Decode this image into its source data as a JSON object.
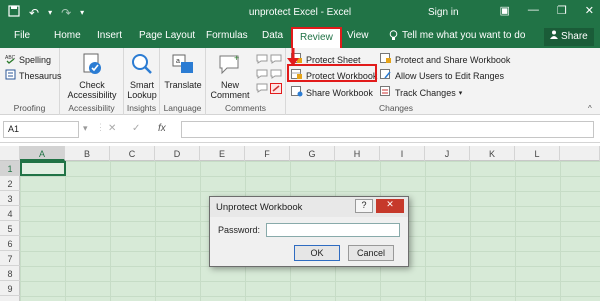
{
  "window": {
    "title": "unprotect Excel  -  Excel",
    "signin": "Sign in",
    "minimize": "—",
    "restore": "❐",
    "close": "✕"
  },
  "tabs": [
    "File",
    "Home",
    "Insert",
    "Page Layout",
    "Formulas",
    "Data",
    "Review",
    "View"
  ],
  "tell_me": "Tell me what you want to do",
  "share": "Share",
  "ribbon": {
    "proofing": {
      "label": "Proofing",
      "spelling": "Spelling",
      "thesaurus": "Thesaurus"
    },
    "accessibility": {
      "label": "Accessibility",
      "check_line1": "Check",
      "check_line2": "Accessibility"
    },
    "insights": {
      "label": "Insights",
      "line1": "Smart",
      "line2": "Lookup"
    },
    "language": {
      "label": "Language",
      "translate": "Translate"
    },
    "comments": {
      "label": "Comments",
      "line1": "New",
      "line2": "Comment"
    },
    "changes": {
      "label": "Changes",
      "protect_sheet": "Protect Sheet",
      "protect_workbook": "Protect Workbook",
      "share_workbook": "Share Workbook",
      "protect_share": "Protect and Share Workbook",
      "allow_users": "Allow Users to Edit Ranges",
      "track_changes": "Track Changes"
    }
  },
  "formula_bar": {
    "name_box": "A1",
    "cancel": "✕",
    "enter": "✓",
    "fx": "fx"
  },
  "columns": [
    "A",
    "B",
    "C",
    "D",
    "E",
    "F",
    "G",
    "H",
    "I",
    "J",
    "K",
    "L"
  ],
  "rows": [
    "1",
    "2",
    "3",
    "4",
    "5",
    "6",
    "7",
    "8",
    "9"
  ],
  "dialog": {
    "title": "Unprotect Workbook",
    "help": "?",
    "close": "✕",
    "password_label": "Password:",
    "password_value": "",
    "ok": "OK",
    "cancel": "Cancel"
  },
  "colors": {
    "excel_green": "#217346",
    "highlight_red": "#e21b1b",
    "sheet_tint": "#d7ead7"
  }
}
